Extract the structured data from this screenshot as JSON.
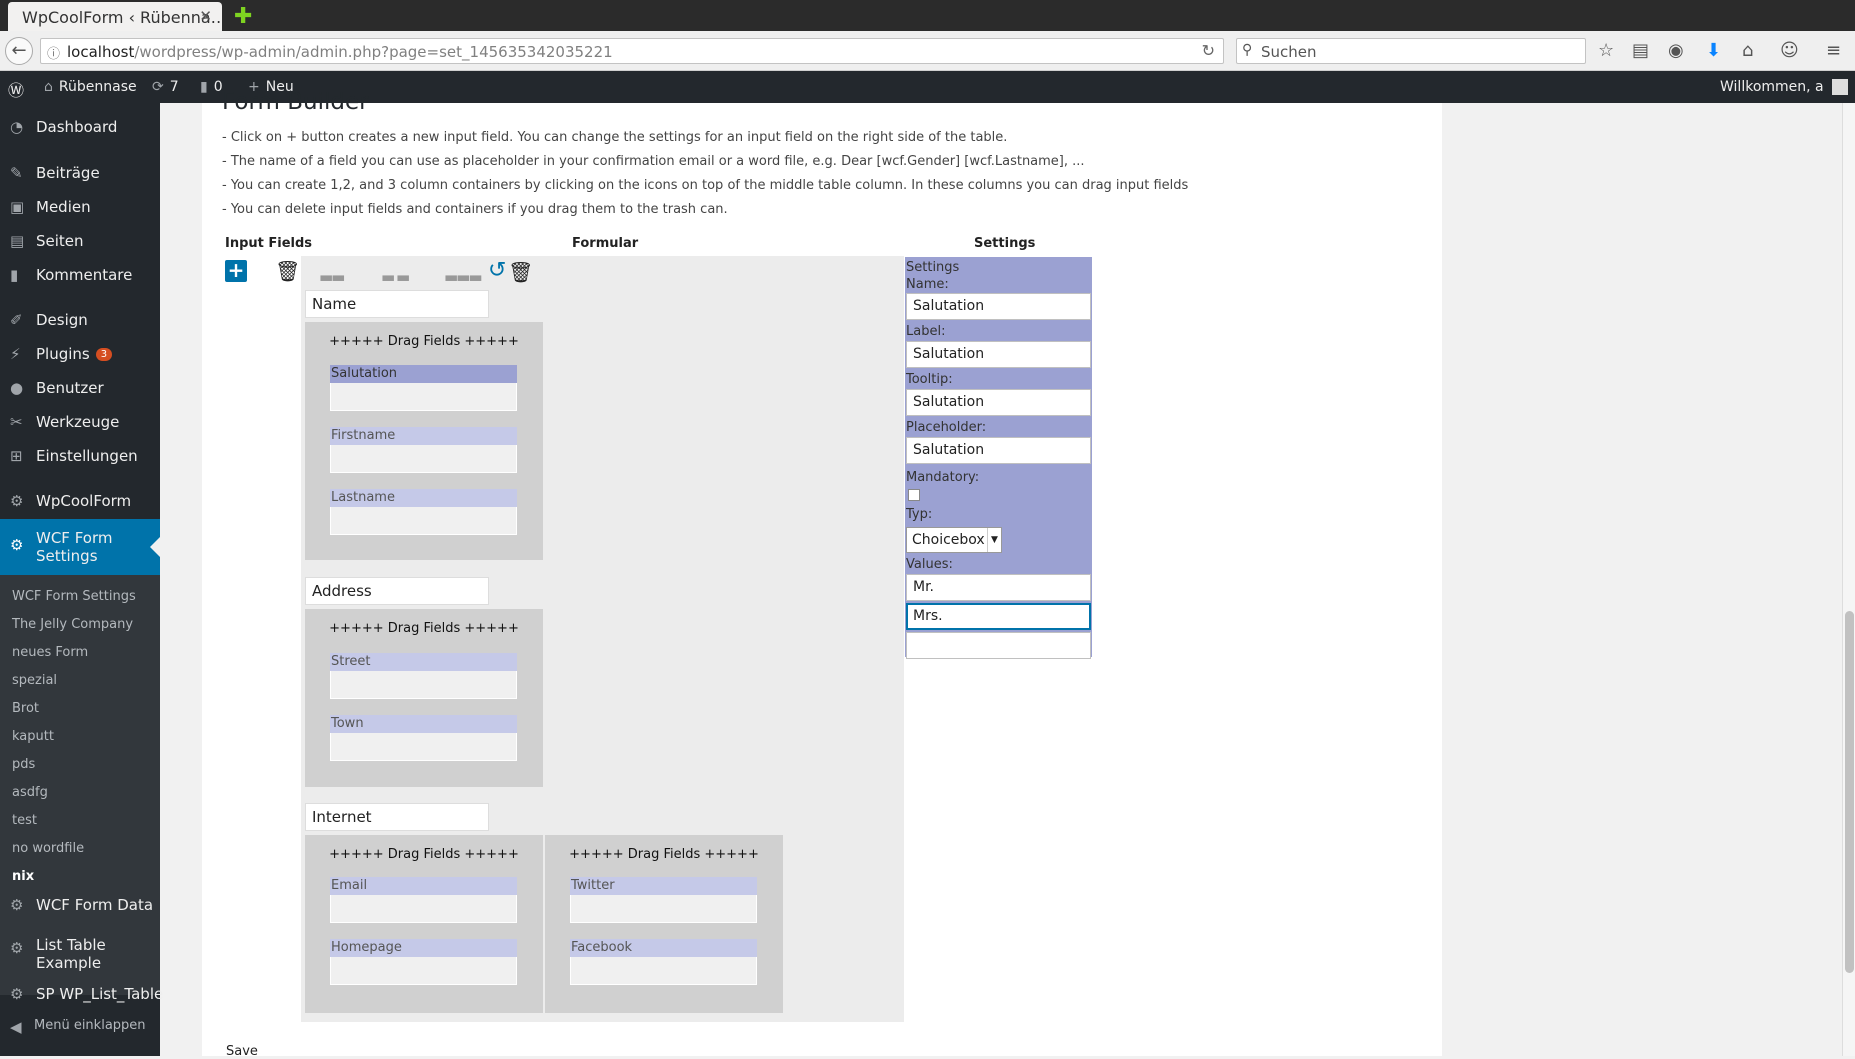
{
  "browser": {
    "tab_title": "WpCoolForm ‹ Rübenna…",
    "tab_close": "✕",
    "url_host": "localhost",
    "url_path": "/wordpress/wp-admin/admin.php?page=set_145635342035221",
    "search_placeholder": "Suchen"
  },
  "adminbar": {
    "site_name": "Rübennase",
    "updates_count": "7",
    "comments_count": "0",
    "new_label": "Neu",
    "greeting": "Willkommen, a"
  },
  "sidebar": {
    "items": [
      {
        "label": "Dashboard",
        "icon": "dashboard-icon"
      },
      {
        "label": "Beiträge",
        "icon": "pin-icon"
      },
      {
        "label": "Medien",
        "icon": "media-icon"
      },
      {
        "label": "Seiten",
        "icon": "page-icon"
      },
      {
        "label": "Kommentare",
        "icon": "comment-icon"
      },
      {
        "label": "Design",
        "icon": "brush-icon"
      },
      {
        "label": "Plugins",
        "icon": "plugin-icon",
        "badge": "3"
      },
      {
        "label": "Benutzer",
        "icon": "user-icon"
      },
      {
        "label": "Werkzeuge",
        "icon": "wrench-icon"
      },
      {
        "label": "Einstellungen",
        "icon": "settings-icon"
      },
      {
        "label": "WpCoolForm",
        "icon": "gear-icon"
      },
      {
        "label": "WCF Form Settings",
        "icon": "gear-icon"
      },
      {
        "label": "WCF Form Data",
        "icon": "gear-icon"
      },
      {
        "label": "List Table Example",
        "icon": "gear-icon"
      },
      {
        "label": "SP WP_List_Table",
        "icon": "gear-icon"
      },
      {
        "label": "Menü einklappen",
        "icon": "collapse-icon"
      }
    ],
    "submenu": [
      "WCF Form Settings",
      "The Jelly Company",
      "neues Form",
      "spezial",
      "Brot",
      "kaputt",
      "pds",
      "asdfg",
      "test",
      "no wordfile",
      "nix"
    ]
  },
  "page": {
    "title": "Form Builder",
    "instructions": [
      "- Click on + button creates a new input field. You can change the settings for an input field on the right side of the table.",
      "- The name of a field you can use as placeholder in your confirmation email or a word file, e.g. Dear [wcf.Gender] [wcf.Lastname], ...",
      "- You can create 1,2, and 3 column containers by clicking on the icons on top of the middle table column. In these columns you can drag input fields",
      "- You can delete input fields and containers if you drag them to the trash can."
    ],
    "col_input_fields": "Input Fields",
    "col_formular": "Formular",
    "col_settings": "Settings",
    "drag_text": "+++++ Drag Fields +++++",
    "save_label": "Save"
  },
  "groups": [
    {
      "title": "Name",
      "fields": [
        "Salutation",
        "Firstname",
        "Lastname"
      ]
    },
    {
      "title": "Address",
      "fields": [
        "Street",
        "Town"
      ]
    },
    {
      "title": "Internet",
      "col1": [
        "Email",
        "Homepage"
      ],
      "col2": [
        "Twitter",
        "Facebook"
      ]
    }
  ],
  "settings_panel": {
    "header": "Settings",
    "name_label": "Name:",
    "name_value": "Salutation",
    "label_label": "Label:",
    "label_value": "Salutation",
    "tooltip_label": "Tooltip:",
    "tooltip_value": "Salutation",
    "placeholder_label": "Placeholder:",
    "placeholder_value": "Salutation",
    "mandatory_label": "Mandatory:",
    "typ_label": "Typ:",
    "typ_value": "Choicebox",
    "values_label": "Values:",
    "values": [
      "Mr.",
      "Mrs.",
      ""
    ]
  }
}
